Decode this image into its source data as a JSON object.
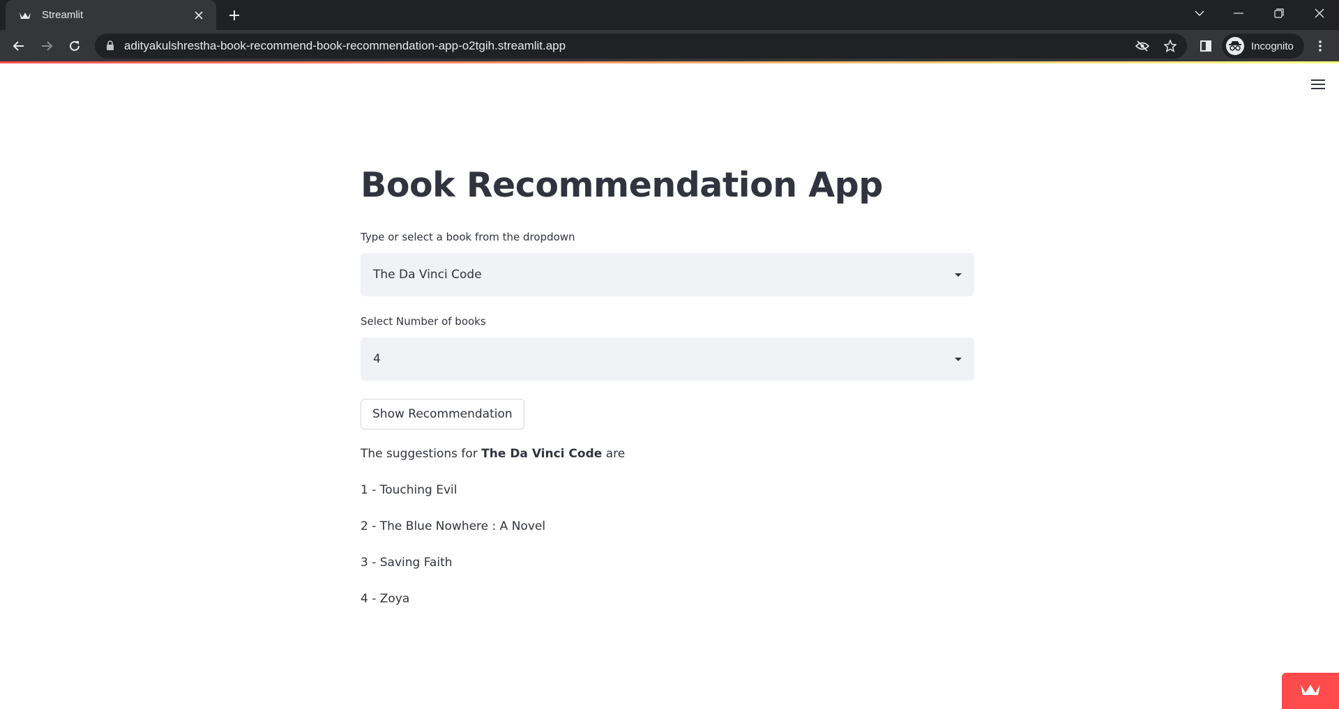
{
  "browser": {
    "tab": {
      "title": "Streamlit",
      "favicon": "streamlit-crown-icon"
    },
    "url": "adityakulshrestha-book-recommend-book-recommendation-app-o2tgih.streamlit.app",
    "profile_label": "Incognito",
    "icons": [
      "back-icon",
      "forward-icon",
      "reload-icon",
      "lock-icon",
      "eye-off-icon",
      "star-icon",
      "side-panel-icon",
      "incognito-icon",
      "tab-search-icon",
      "minimize-icon",
      "restore-icon",
      "close-icon"
    ]
  },
  "app": {
    "title": "Book Recommendation App",
    "book_select": {
      "label": "Type or select a book from the dropdown",
      "value": "The Da Vinci Code"
    },
    "count_select": {
      "label": "Select Number of books",
      "value": "4"
    },
    "button_label": "Show Recommendation",
    "suggestion": {
      "prefix": "The suggestions for",
      "book": "The Da Vinci Code",
      "suffix": "are"
    },
    "recommendations": [
      "1 - Touching Evil",
      "2 - The Blue Nowhere : A Novel",
      "3 - Saving Faith",
      "4 - Zoya"
    ]
  },
  "colors": {
    "accent": "#ff4b4b",
    "text": "#31333f",
    "input_bg": "#f0f2f6",
    "chrome_dark": "#202124",
    "chrome_tab": "#35363a"
  }
}
